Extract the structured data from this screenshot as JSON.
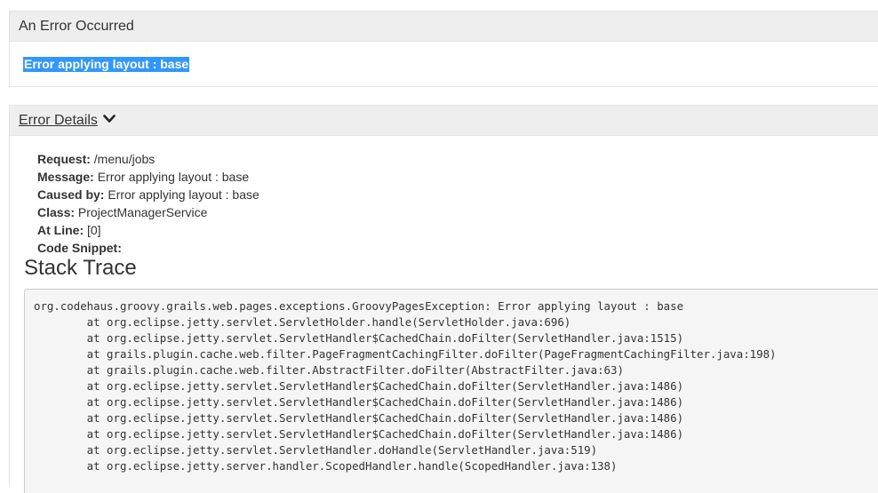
{
  "error_panel": {
    "heading": "An Error Occurred",
    "message": "Error applying layout : base"
  },
  "details_panel": {
    "toggle_label": "Error Details",
    "fields": [
      {
        "label": "Request:",
        "value": "/menu/jobs"
      },
      {
        "label": "Message:",
        "value": "Error applying layout : base"
      },
      {
        "label": "Caused by:",
        "value": "Error applying layout : base"
      },
      {
        "label": "Class:",
        "value": "ProjectManagerService"
      },
      {
        "label": "At Line:",
        "value": "[0]"
      },
      {
        "label": "Code Snippet:",
        "value": ""
      }
    ]
  },
  "stack_trace": {
    "title": "Stack Trace",
    "lines": [
      "org.codehaus.groovy.grails.web.pages.exceptions.GroovyPagesException: Error applying layout : base",
      "        at org.eclipse.jetty.servlet.ServletHolder.handle(ServletHolder.java:696)",
      "        at org.eclipse.jetty.servlet.ServletHandler$CachedChain.doFilter(ServletHandler.java:1515)",
      "        at grails.plugin.cache.web.filter.PageFragmentCachingFilter.doFilter(PageFragmentCachingFilter.java:198)",
      "        at grails.plugin.cache.web.filter.AbstractFilter.doFilter(AbstractFilter.java:63)",
      "        at org.eclipse.jetty.servlet.ServletHandler$CachedChain.doFilter(ServletHandler.java:1486)",
      "        at org.eclipse.jetty.servlet.ServletHandler$CachedChain.doFilter(ServletHandler.java:1486)",
      "        at org.eclipse.jetty.servlet.ServletHandler$CachedChain.doFilter(ServletHandler.java:1486)",
      "        at org.eclipse.jetty.servlet.ServletHandler$CachedChain.doFilter(ServletHandler.java:1486)",
      "        at org.eclipse.jetty.servlet.ServletHandler.doHandle(ServletHandler.java:519)",
      "        at org.eclipse.jetty.server.handler.ScopedHandler.handle(ScopedHandler.java:138)"
    ]
  },
  "colors": {
    "selection_highlight": "#3297fd",
    "panel_heading_bg": "#eeeeee",
    "pre_bg": "#f5f5f5"
  },
  "icons": {
    "toggle_icon": "chevron-down-icon"
  }
}
